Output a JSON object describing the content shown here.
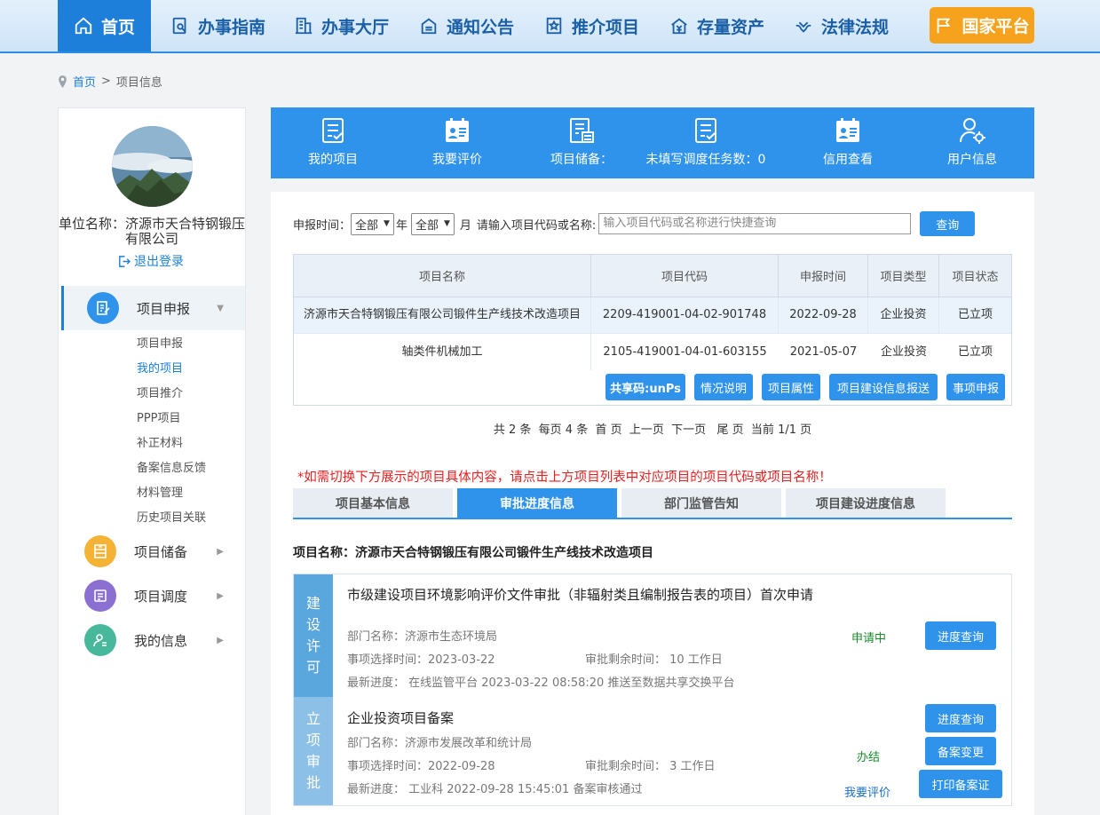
{
  "nav": {
    "items": [
      {
        "label": "首页",
        "icon": "home-icon"
      },
      {
        "label": "办事指南",
        "icon": "guide-icon"
      },
      {
        "label": "办事大厅",
        "icon": "building-icon"
      },
      {
        "label": "通知公告",
        "icon": "notice-icon"
      },
      {
        "label": "推介项目",
        "icon": "star-icon"
      },
      {
        "label": "存量资产",
        "icon": "asset-icon"
      },
      {
        "label": "法律法规",
        "icon": "law-icon"
      },
      {
        "label": "国家平台",
        "icon": "flag-icon"
      }
    ]
  },
  "breadcrumb": {
    "home": "首页",
    "sep": ">",
    "current": "项目信息"
  },
  "sidebar": {
    "unit": "单位名称：济源市天合特钢锻压有限公司",
    "logout": "退出登录",
    "groups": [
      {
        "label": "项目申报",
        "icon": "doc-edit-icon",
        "color": "#2f93ec"
      },
      {
        "label": "项目储备",
        "icon": "storage-icon",
        "color": "#f5b335"
      },
      {
        "label": "项目调度",
        "icon": "schedule-icon",
        "color": "#8b6fd1"
      },
      {
        "label": "我的信息",
        "icon": "user-icon",
        "color": "#48b89c"
      }
    ],
    "sub_items": [
      "项目申报",
      "我的项目",
      "项目推介",
      "PPP项目",
      "补正材料",
      "备案信息反馈",
      "材料管理",
      "历史项目关联"
    ]
  },
  "toolbar": [
    {
      "label": "我的项目",
      "icon": "list-check-icon"
    },
    {
      "label": "我要评价",
      "icon": "evaluate-icon"
    },
    {
      "label": "项目储备：",
      "icon": "reserve-icon"
    },
    {
      "label": "未填写调度任务数：0",
      "icon": "task-icon"
    },
    {
      "label": "信用查看",
      "icon": "credit-icon"
    },
    {
      "label": "用户信息",
      "icon": "user-settings-icon"
    }
  ],
  "filter": {
    "label_time": "申报时间：",
    "year_value": "全部",
    "year_unit": "年",
    "month_value": "全部",
    "month_unit": "月",
    "search_label": "请输入项目代码或名称:",
    "placeholder": "输入项目代码或名称进行快捷查询",
    "search_button": "查询"
  },
  "table": {
    "headers": [
      "项目名称",
      "项目代码",
      "申报时间",
      "项目类型",
      "项目状态"
    ],
    "rows": [
      {
        "name": "济源市天合特钢锻压有限公司锻件生产线技术改造项目",
        "code": "2209-419001-04-02-901748",
        "date": "2022-09-28",
        "type": "企业投资",
        "status": "已立项"
      },
      {
        "name": "轴类件机械加工",
        "code": "2105-419001-04-01-603155",
        "date": "2021-05-07",
        "type": "企业投资",
        "status": "已立项"
      }
    ],
    "actions": [
      "共享码:unPs",
      "情况说明",
      "项目属性",
      "项目建设信息报送",
      "事项申报"
    ]
  },
  "pager": {
    "text": "共 2 条  每页 4 条  首 页  上一页  下一页   尾 页  当前 1/1 页"
  },
  "notice": "*如需切换下方展示的项目具体内容，请点击上方项目列表中对应项目的项目代码或项目名称！",
  "tabs": [
    "项目基本信息",
    "审批进度信息",
    "部门监管告知",
    "项目建设进度信息"
  ],
  "detail": {
    "project_name": "项目名称：济源市天合特钢锻压有限公司锻件生产线技术改造项目",
    "groups": [
      {
        "stage": "建设许可",
        "color": "#5aa7dd",
        "title": "市级建设项目环境影响评价文件审批（非辐射类且编制报告表的项目）首次申请",
        "dept": "部门名称：济源市生态环境局",
        "select_time": "事项选择时间：2023-03-22",
        "remaining": "审批剩余时间： 10 工作日",
        "progress": "最新进度： 在线监管平台 2023-03-22 08:58:20  推送至数据共享交换平台",
        "status": "申请中",
        "buttons": [
          "进度查询"
        ]
      },
      {
        "stage": "立项审批",
        "color": "#8cc0e6",
        "title": "企业投资项目备案",
        "dept": "部门名称：济源市发展改革和统计局",
        "select_time": "事项选择时间：2022-09-28",
        "remaining": "审批剩余时间： 3 工作日",
        "progress": "最新进度： 工业科 2022-09-28 15:45:01 备案审核通过",
        "status": "办结",
        "eval": "我要评价",
        "buttons": [
          "进度查询",
          "备案变更",
          "打印备案证"
        ]
      }
    ]
  }
}
